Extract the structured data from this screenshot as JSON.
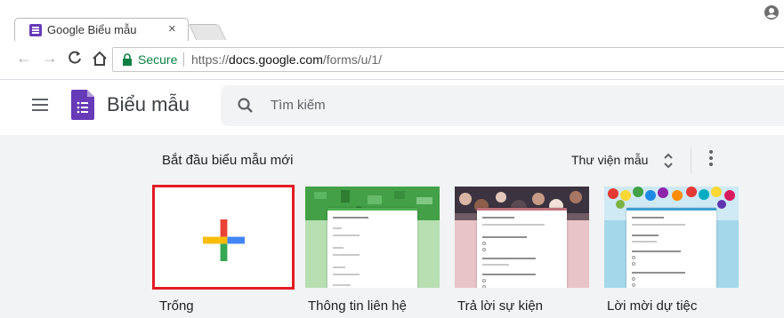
{
  "browser": {
    "tab_title": "Google Biểu mẫu",
    "tab_close": "×",
    "secure_label": "Secure",
    "url_scheme": "https://",
    "url_host": "docs.google.com",
    "url_path": "/forms/u/1/",
    "nav_back": "←",
    "nav_forward": "→",
    "nav_reload": "C",
    "icons": [
      "back-arrow-icon",
      "forward-arrow-icon",
      "reload-icon",
      "home-icon",
      "lock-icon",
      "profile-icon"
    ]
  },
  "app": {
    "title": "Biểu mẫu",
    "search_placeholder": "Tìm kiếm",
    "brand_color": "#673ab7",
    "icons": [
      "menu-icon",
      "forms-logo-icon",
      "search-icon"
    ]
  },
  "gallery": {
    "title": "Bắt đầu biểu mẫu mới",
    "library_label": "Thư viện mẫu",
    "background": "#f1f3f4",
    "icons": [
      "expand-icon",
      "more-vert-icon"
    ],
    "templates": [
      {
        "label": "Trống",
        "selected": true,
        "icon": "plus-icon"
      },
      {
        "label": "Thông tin liên hệ",
        "color": "#4caf50"
      },
      {
        "label": "Trả lời sự kiện",
        "color": "#c0717b"
      },
      {
        "label": "Lời mời dự tiệc",
        "color": "#3f9fd1"
      }
    ],
    "selection_color": "#e31b23"
  }
}
